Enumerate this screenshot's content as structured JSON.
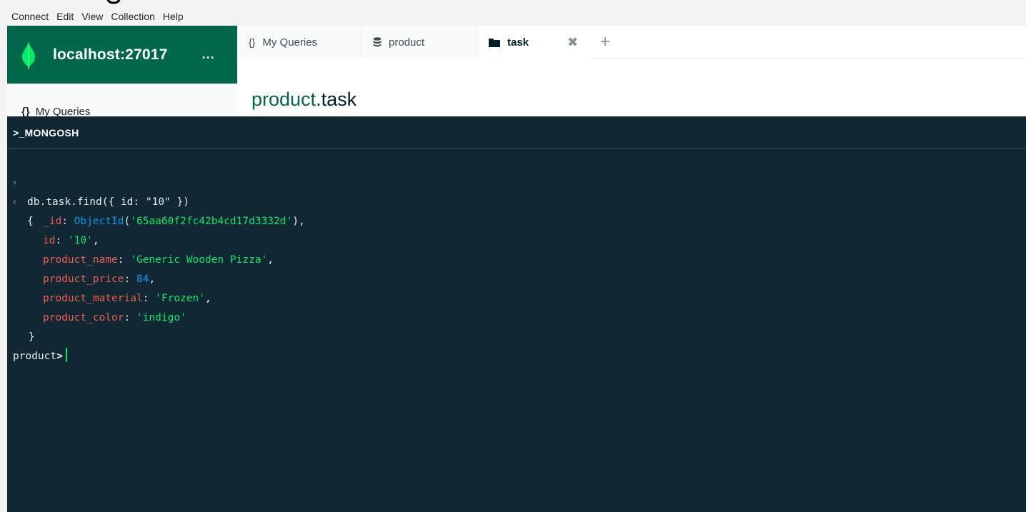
{
  "menu": [
    "Connect",
    "Edit",
    "View",
    "Collection",
    "Help"
  ],
  "connection": {
    "host": "localhost:27017",
    "more": "..."
  },
  "sidebar": {
    "my_queries": "My Queries",
    "my_queries_icon": "{}"
  },
  "tabs": [
    {
      "label": "My Queries",
      "icon": "curly-braces-icon"
    },
    {
      "label": "product",
      "icon": "database-icon"
    },
    {
      "label": "task",
      "icon": "folder-icon"
    }
  ],
  "namespace": {
    "db": "product",
    "collection": ".task"
  },
  "shell": {
    "title": ">_MONGOSH",
    "command": "db.task.find({ id: \"10\" })",
    "result": {
      "_id_key": "_id",
      "_id_fn": "ObjectId",
      "_id_value": "'65aa60f2fc42b4cd17d3332d'",
      "id_key": "id",
      "id_value": "'10'",
      "product_name_key": "product_name",
      "product_name_value": "'Generic Wooden Pizza'",
      "product_price_key": "product_price",
      "product_price_value": "84",
      "product_material_key": "product_material",
      "product_material_value": "'Frozen'",
      "product_color_key": "product_color",
      "product_color_value": "'indigo'"
    },
    "prompt": "product"
  },
  "colors": {
    "brand_green": "#00684a",
    "shell_bg": "#112733",
    "key": "#ef5f4e",
    "string": "#00ed64",
    "number": "#0498ec"
  }
}
